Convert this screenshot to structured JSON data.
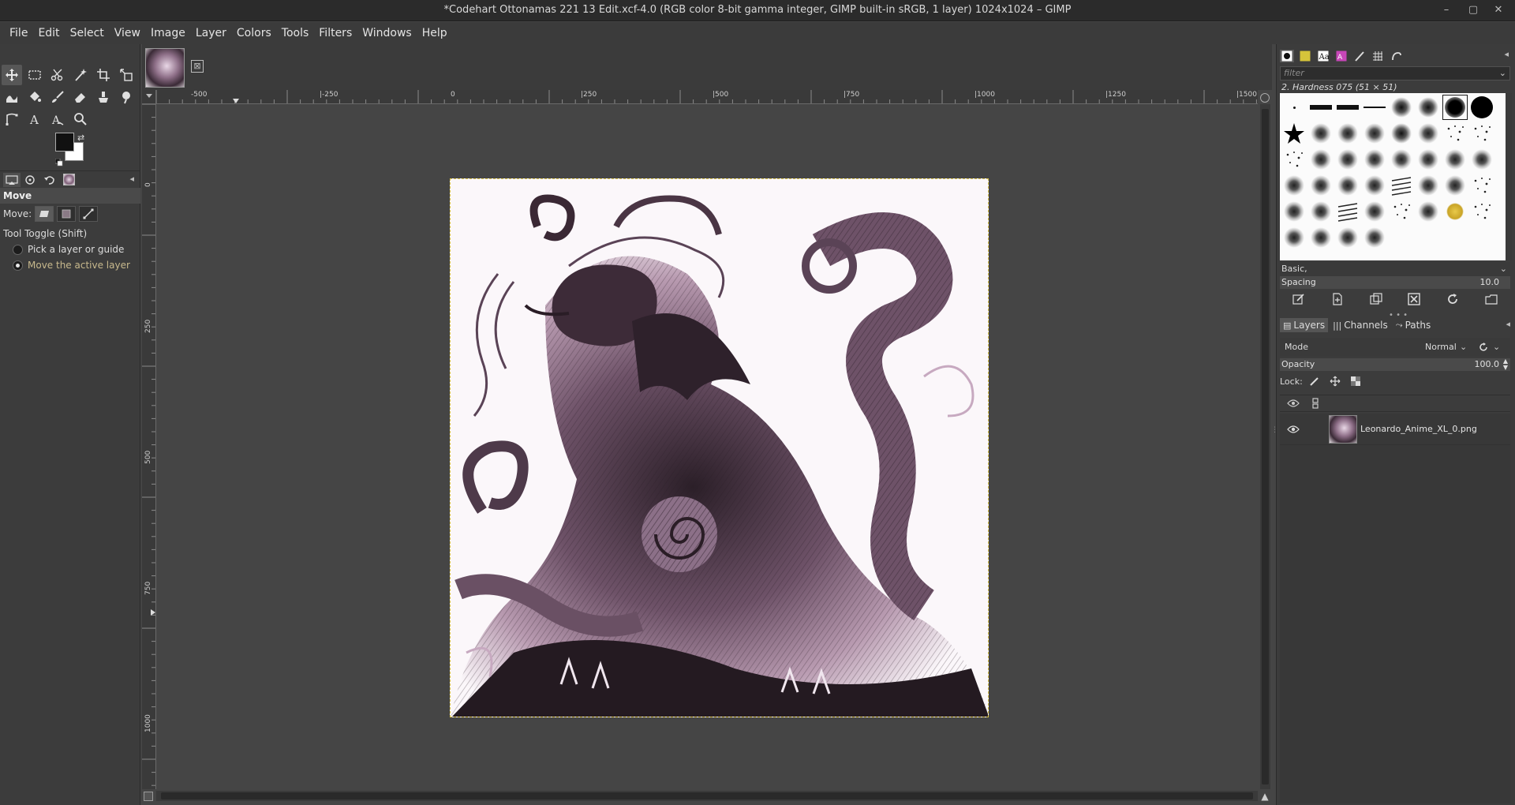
{
  "window": {
    "title": "*Codehart Ottonamas 221 13 Edit.xcf-4.0 (RGB color 8-bit gamma integer, GIMP built-in sRGB, 1 layer) 1024x1024 – GIMP",
    "minimize_glyph": "–",
    "maximize_glyph": "▢",
    "close_glyph": "✕"
  },
  "menubar": {
    "items": [
      "File",
      "Edit",
      "Select",
      "View",
      "Image",
      "Layer",
      "Colors",
      "Tools",
      "Filters",
      "Windows",
      "Help"
    ]
  },
  "toolbox": {
    "tools": [
      "move-tool-icon",
      "rect-select-icon",
      "scissors-icon",
      "fuzzy-select-icon",
      "crop-icon",
      "transform-icon",
      "warp-icon",
      "bucket-fill-icon",
      "paintbrush-icon",
      "eraser-icon",
      "clone-icon",
      "smudge-icon",
      "paths-icon",
      "text-icon",
      "text-style-icon",
      "zoom-icon"
    ],
    "active_tool": "move-tool-icon",
    "foreground_color": "#111111",
    "background_color": "#ffffff"
  },
  "tool_options": {
    "title": "Move",
    "move_label": "Move:",
    "toggle_label": "Tool Toggle  (Shift)",
    "options": [
      {
        "label": "Pick a layer or guide",
        "selected": false
      },
      {
        "label": "Move the active layer",
        "selected": true
      }
    ]
  },
  "image_tab": {
    "close_glyph": "⊠"
  },
  "rulers": {
    "horizontal_labels": [
      "-500",
      "|-250",
      "0",
      "|250",
      "|500",
      "|750",
      "|1000",
      "|1250",
      "|1500"
    ],
    "vertical_labels": [
      "0",
      "250",
      "500",
      "750",
      "1000"
    ]
  },
  "canvas": {
    "background": "#454545",
    "image_width": 1024,
    "image_height": 1024
  },
  "brushes": {
    "filter_placeholder": "filter",
    "selected_brush": "2. Hardness 075 (51 × 51)",
    "preset": "Basic,",
    "spacing_label": "Spacing",
    "spacing_value": "10.0"
  },
  "layers_panel": {
    "tabs": [
      "Layers",
      "Channels",
      "Paths"
    ],
    "mode_label": "Mode",
    "mode_value": "Normal",
    "opacity_label": "Opacity",
    "opacity_value": "100.0",
    "lock_label": "Lock:",
    "layers": [
      {
        "name": "Leonardo_Anime_XL_0.png",
        "visible": true
      }
    ]
  }
}
